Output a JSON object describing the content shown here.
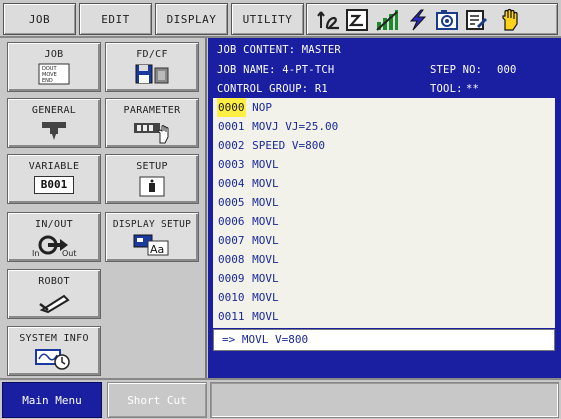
{
  "menu": {
    "job": "JOB",
    "edit": "EDIT",
    "display": "DISPLAY",
    "utility": "UTILITY"
  },
  "toolbar_icons": [
    "coordinate-icon",
    "teach-mode-icon",
    "signal-bars-icon",
    "lightning-icon",
    "camera-icon",
    "edit-icon",
    "hand-icon"
  ],
  "main_menu": {
    "job": "JOB",
    "job_icon_text": [
      "DOUT",
      "MOVE",
      "END"
    ],
    "fdcf": "FD/CF",
    "general": "GENERAL",
    "parameter": "PARAMETER",
    "variable": "VARIABLE",
    "variable_box": "B001",
    "setup": "SETUP",
    "inout": "IN/OUT",
    "inout_in": "In",
    "inout_out": "Out",
    "display_setup": "DISPLAY SETUP",
    "display_setup_aa": "Aa",
    "robot": "ROBOT",
    "system_info": "SYSTEM INFO"
  },
  "job_window": {
    "job_content": "JOB CONTENT: MASTER",
    "job_name": "JOB NAME: 4-PT-TCH",
    "step_no_label": "STEP NO:",
    "step_no_value": "000",
    "control_group": "CONTROL GROUP: R1",
    "tool_label": "TOOL:",
    "tool_value": "**"
  },
  "lines": [
    {
      "num": "0000",
      "text": "NOP",
      "selected": true
    },
    {
      "num": "0001",
      "text": "MOVJ VJ=25.00",
      "selected": false
    },
    {
      "num": "0002",
      "text": "SPEED V=800",
      "selected": false
    },
    {
      "num": "0003",
      "text": "MOVL",
      "selected": false
    },
    {
      "num": "0004",
      "text": "MOVL",
      "selected": false
    },
    {
      "num": "0005",
      "text": "MOVL",
      "selected": false
    },
    {
      "num": "0006",
      "text": "MOVL",
      "selected": false
    },
    {
      "num": "0007",
      "text": "MOVL",
      "selected": false
    },
    {
      "num": "0008",
      "text": "MOVL",
      "selected": false
    },
    {
      "num": "0009",
      "text": "MOVL",
      "selected": false
    },
    {
      "num": "0010",
      "text": "MOVL",
      "selected": false
    },
    {
      "num": "0011",
      "text": "MOVL",
      "selected": false
    }
  ],
  "edit_buffer": "=> MOVL V=800",
  "bottom": {
    "main_menu": "Main Menu",
    "short_cut": "Short Cut"
  },
  "colors": {
    "window_blue": "#1a1ea0",
    "selected_line": "#ffee44",
    "text_blue": "#1a2a9a"
  }
}
